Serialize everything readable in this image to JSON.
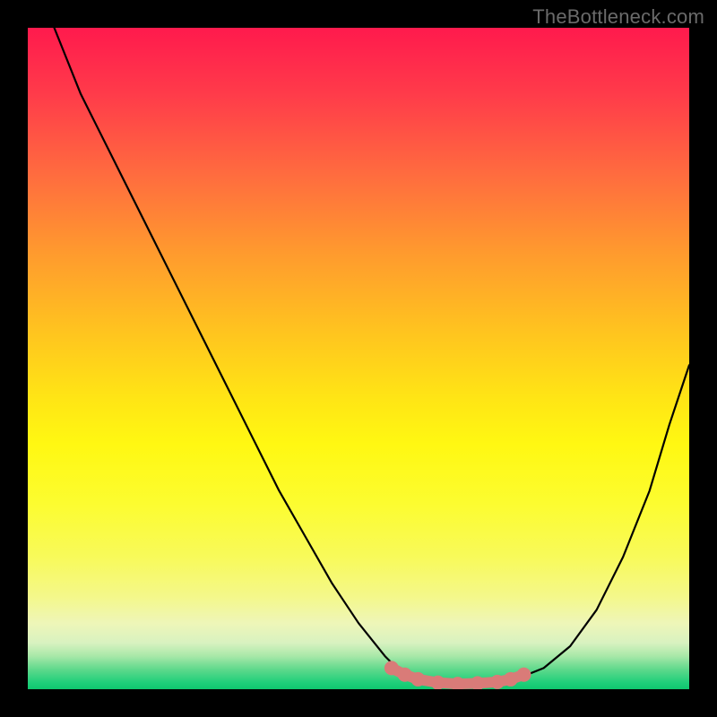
{
  "watermark": "TheBottleneck.com",
  "colors": {
    "frame": "#000000",
    "curve": "#000000",
    "marker_fill": "#d97b78",
    "marker_stroke": "#d97b78"
  },
  "gradient_stops": [
    {
      "pct": 0,
      "color": "#ff1a4d"
    },
    {
      "pct": 10,
      "color": "#ff3b4a"
    },
    {
      "pct": 22,
      "color": "#ff6b3f"
    },
    {
      "pct": 34,
      "color": "#ff9a2e"
    },
    {
      "pct": 46,
      "color": "#ffc41f"
    },
    {
      "pct": 56,
      "color": "#ffe515"
    },
    {
      "pct": 63,
      "color": "#fff812"
    },
    {
      "pct": 72,
      "color": "#fcfc30"
    },
    {
      "pct": 80,
      "color": "#f8fa5a"
    },
    {
      "pct": 86,
      "color": "#f4f88a"
    },
    {
      "pct": 90,
      "color": "#eef6b8"
    },
    {
      "pct": 93,
      "color": "#d8f2c0"
    },
    {
      "pct": 95,
      "color": "#a8e8a8"
    },
    {
      "pct": 97,
      "color": "#5fd98c"
    },
    {
      "pct": 99,
      "color": "#1fcf7a"
    },
    {
      "pct": 100,
      "color": "#0fc76e"
    }
  ],
  "chart_data": {
    "type": "line",
    "title": "",
    "xlabel": "",
    "ylabel": "",
    "xlim": [
      0,
      100
    ],
    "ylim": [
      0,
      100
    ],
    "series": [
      {
        "name": "bottleneck-curve",
        "x": [
          4,
          6,
          8,
          10,
          14,
          18,
          22,
          26,
          30,
          34,
          38,
          42,
          46,
          50,
          54,
          56,
          58,
          60,
          63,
          66,
          70,
          74,
          78,
          82,
          86,
          90,
          94,
          97,
          100
        ],
        "y": [
          100,
          95,
          90,
          86,
          78,
          70,
          62,
          54,
          46,
          38,
          30,
          23,
          16,
          10,
          5,
          3,
          2,
          1.2,
          0.8,
          0.8,
          1.0,
          1.6,
          3.2,
          6.5,
          12,
          20,
          30,
          40,
          49
        ]
      }
    ],
    "markers": {
      "name": "optimal-range",
      "x": [
        55,
        57,
        59,
        62,
        65,
        68,
        71,
        73,
        75
      ],
      "y": [
        3.2,
        2.2,
        1.5,
        1.0,
        0.8,
        0.9,
        1.1,
        1.5,
        2.2
      ]
    },
    "annotations": []
  }
}
